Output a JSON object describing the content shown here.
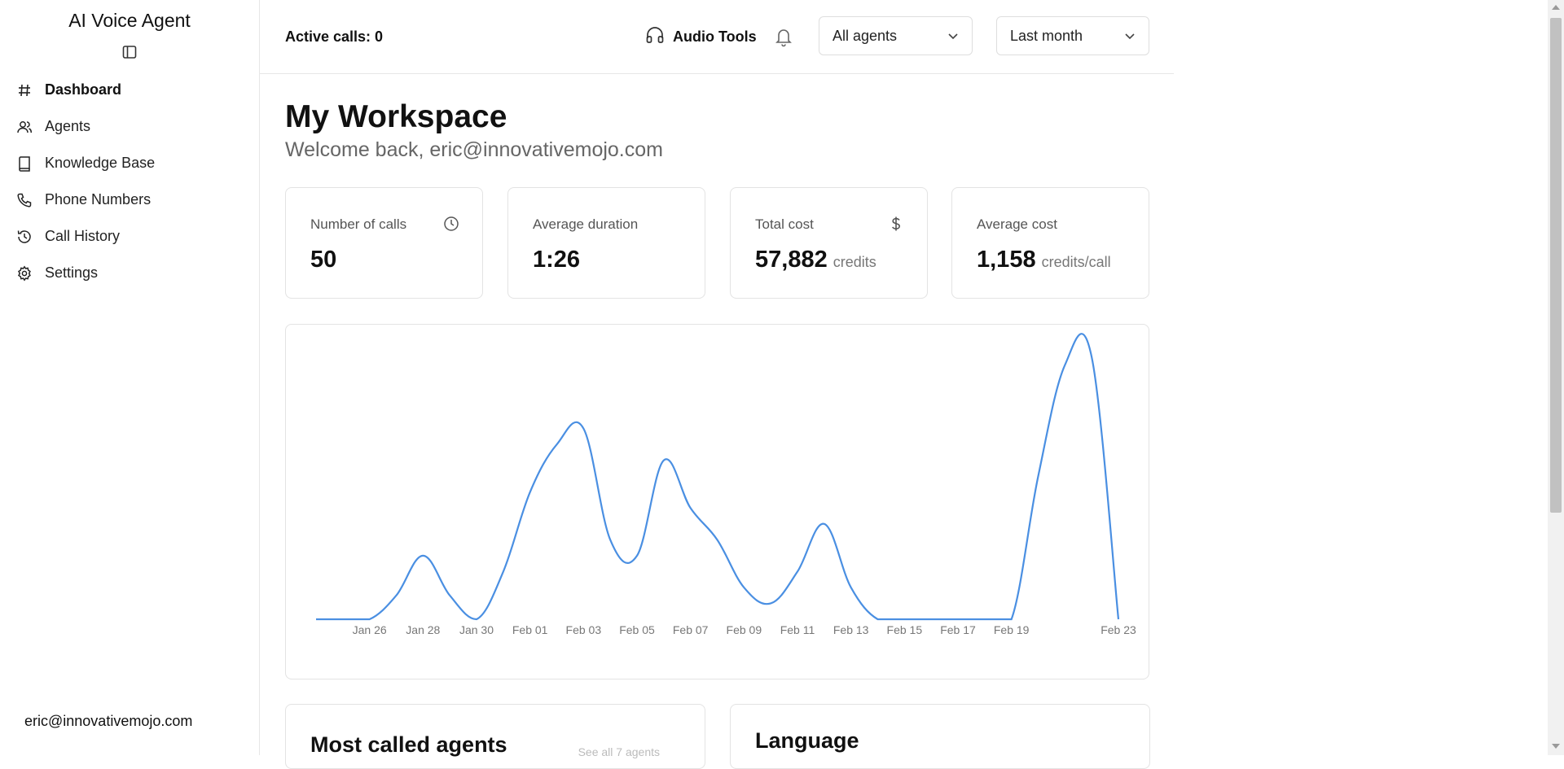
{
  "app": {
    "title": "AI Voice Agent"
  },
  "sidebar": {
    "items": [
      {
        "label": "Dashboard",
        "icon": "hash-icon",
        "active": true
      },
      {
        "label": "Agents",
        "icon": "users-icon"
      },
      {
        "label": "Knowledge Base",
        "icon": "book-icon"
      },
      {
        "label": "Phone Numbers",
        "icon": "phone-icon"
      },
      {
        "label": "Call History",
        "icon": "history-icon"
      },
      {
        "label": "Settings",
        "icon": "gear-icon"
      }
    ],
    "user_email": "eric@innovativemojo.com"
  },
  "header": {
    "active_calls": "Active calls: 0",
    "audio_tools": "Audio Tools",
    "agent_filter": "All agents",
    "period_filter": "Last month"
  },
  "main": {
    "title": "My Workspace",
    "welcome": "Welcome back, eric@innovativemojo.com"
  },
  "stats": [
    {
      "label": "Number of calls",
      "value": "50",
      "unit": "",
      "icon": "clock-icon"
    },
    {
      "label": "Average duration",
      "value": "1:26",
      "unit": ""
    },
    {
      "label": "Total cost",
      "value": "57,882",
      "unit": "credits",
      "icon": "dollar-icon"
    },
    {
      "label": "Average cost",
      "value": "1,158",
      "unit": "credits/call"
    }
  ],
  "bottom": {
    "most_called": "Most called agents",
    "see_all": "See all 7 agents",
    "language": "Language"
  },
  "colors": {
    "accent": "#4a8fe2",
    "border": "#e3e3e3"
  },
  "chart_data": {
    "type": "line",
    "x_labels": [
      "Jan 26",
      "Jan 28",
      "Jan 30",
      "Feb 01",
      "Feb 03",
      "Feb 05",
      "Feb 07",
      "Feb 09",
      "Feb 11",
      "Feb 13",
      "Feb 15",
      "Feb 17",
      "Feb 19",
      "Feb 23"
    ],
    "x": [
      "Jan 24",
      "Jan 25",
      "Jan 26",
      "Jan 27",
      "Jan 28",
      "Jan 29",
      "Jan 30",
      "Jan 31",
      "Feb 01",
      "Feb 02",
      "Feb 03",
      "Feb 04",
      "Feb 05",
      "Feb 06",
      "Feb 07",
      "Feb 08",
      "Feb 09",
      "Feb 10",
      "Feb 11",
      "Feb 12",
      "Feb 13",
      "Feb 14",
      "Feb 15",
      "Feb 16",
      "Feb 17",
      "Feb 18",
      "Feb 19",
      "Feb 20",
      "Feb 21",
      "Feb 22",
      "Feb 23"
    ],
    "values": [
      0,
      0,
      0,
      1.5,
      4,
      1.5,
      0,
      3,
      8,
      11,
      12,
      5,
      4,
      10,
      7,
      5,
      2,
      1,
      3,
      6,
      2,
      0,
      0,
      0,
      0,
      0,
      0,
      9,
      16,
      16.5,
      0
    ],
    "grid": false,
    "legend": "none"
  }
}
